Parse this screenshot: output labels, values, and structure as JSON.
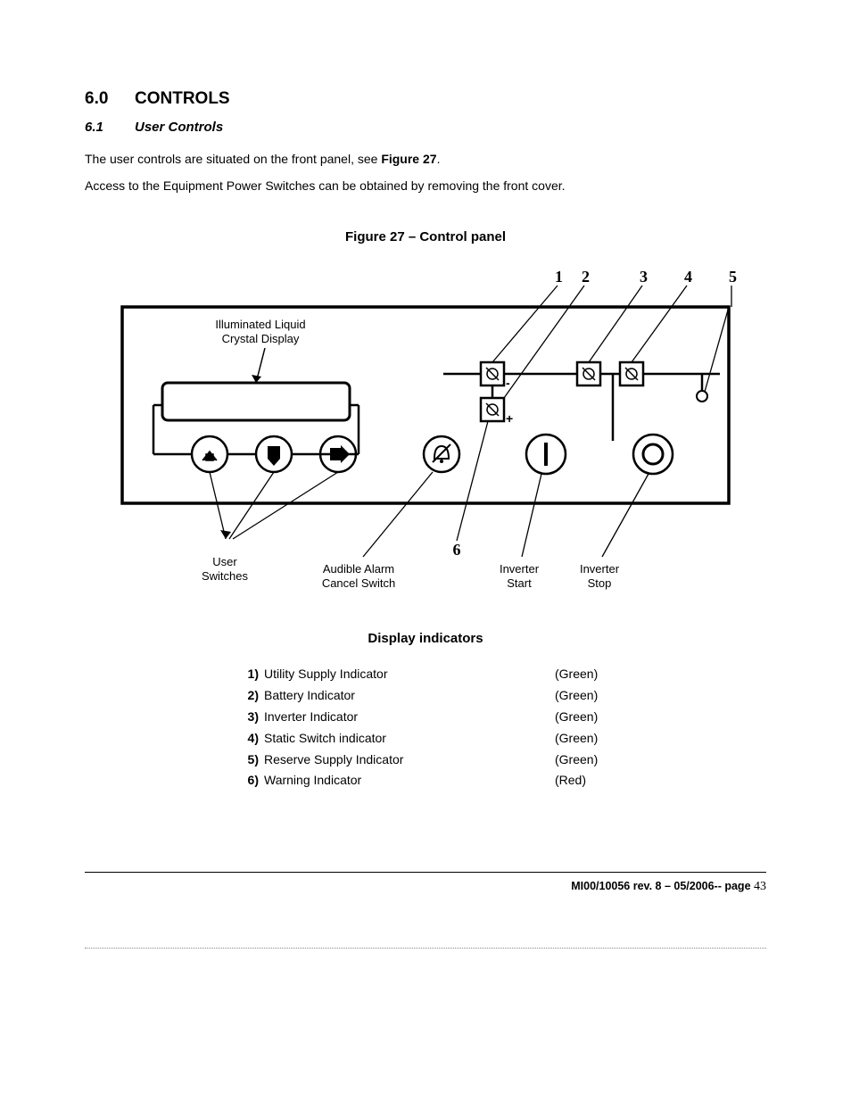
{
  "section": {
    "num": "6.0",
    "title": "CONTROLS"
  },
  "subsection": {
    "num": "6.1",
    "title": "User Controls"
  },
  "para1_pre": "The user controls are situated on the front panel, see ",
  "para1_bold": "Figure 27",
  "para1_post": ".",
  "para2": "Access  to  the Equipment Power Switches  can be obtained by removing the front cover.",
  "figure_caption": "Figure 27 – Control panel",
  "diagram": {
    "lcd_label_line1": "Illuminated Liquid",
    "lcd_label_line2": "Crystal Display",
    "user_switches_line1": "User",
    "user_switches_line2": "Switches",
    "alarm_label_line1": "Audible Alarm",
    "alarm_label_line2": "Cancel Switch",
    "inv_start_line1": "Inverter",
    "inv_start_line2": "Start",
    "inv_stop_line1": "Inverter",
    "inv_stop_line2": "Stop",
    "callouts": {
      "1": "1",
      "2": "2",
      "3": "3",
      "4": "4",
      "5": "5",
      "6": "6"
    }
  },
  "indicators_heading": "Display indicators",
  "indicators": [
    {
      "num": "1)",
      "name": "Utility Supply Indicator",
      "color": "(Green)"
    },
    {
      "num": "2)",
      "name": "Battery Indicator",
      "color": "(Green)"
    },
    {
      "num": "3)",
      "name": "Inverter Indicator",
      "color": "(Green)"
    },
    {
      "num": "4)",
      "name": "Static Switch indicator",
      "color": "(Green)"
    },
    {
      "num": "5)",
      "name": "Reserve Supply Indicator",
      "color": "(Green)"
    },
    {
      "num": "6)",
      "name": "Warning Indicator",
      "color": "(Red)"
    }
  ],
  "footer": {
    "doc": "MI00/10056 rev. 8 – 05/2006-- page ",
    "pagenum": "43"
  }
}
